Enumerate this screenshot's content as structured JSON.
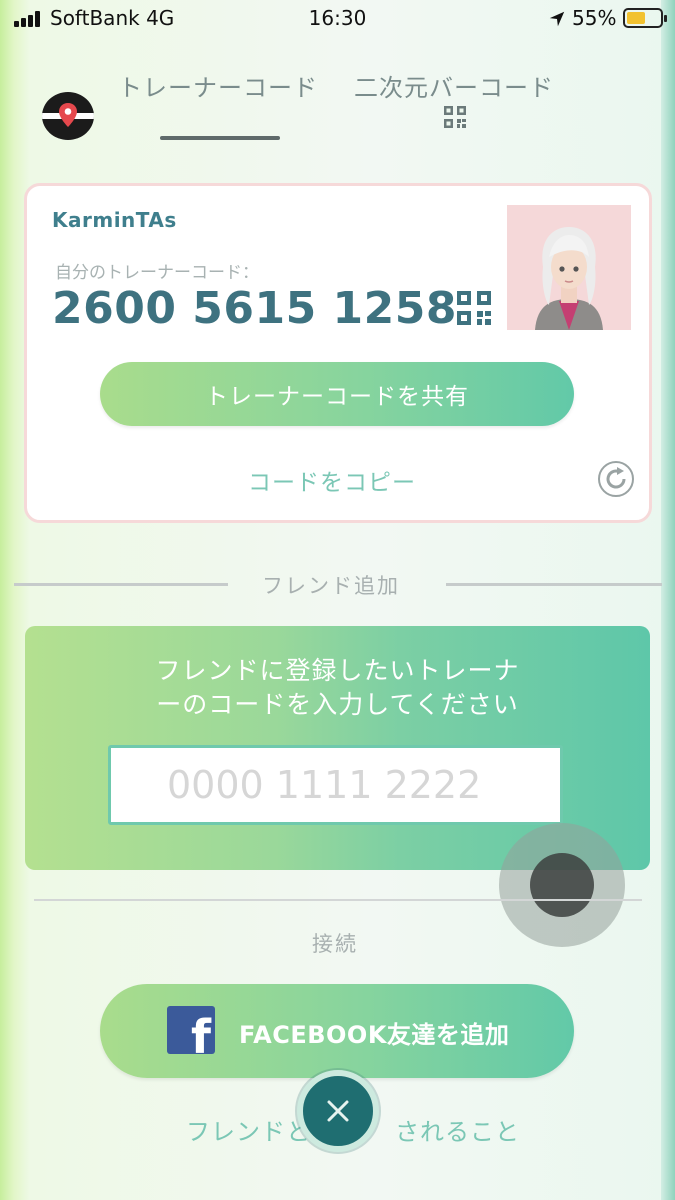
{
  "status_bar": {
    "carrier": "SoftBank",
    "network": "4G",
    "time": "16:30",
    "battery_percent": "55%",
    "battery_level": 0.55,
    "icons": [
      "signal-icon",
      "location-arrow-icon",
      "battery-icon"
    ]
  },
  "tabs": [
    {
      "label": "トレーナーコード",
      "active": true
    },
    {
      "label": "二次元バーコード",
      "active": false
    }
  ],
  "trainer_card": {
    "username": "KarminTAs",
    "code_caption": "自分のトレーナーコード：",
    "code": "2600 5615 1258",
    "share_label": "トレーナーコードを共有",
    "copy_label": "コードをコピー"
  },
  "friend_add": {
    "section_title": "フレンド追加",
    "prompt_line1": "フレンドに登録したいトレーナ",
    "prompt_line2": "ーのコードを入力してください",
    "input_placeholder": "0000 1111 2222",
    "input_value": ""
  },
  "connect": {
    "section_title": "接続",
    "facebook_label": "FACEBOOK友達を追加",
    "bottom_link_left": "フレンドと",
    "bottom_link_right": "されること"
  },
  "colors": {
    "accent_teal": "#3e7280",
    "button_green": "#87d49e",
    "facebook_blue": "#3b5a9a",
    "close_button": "#1f6e71"
  }
}
